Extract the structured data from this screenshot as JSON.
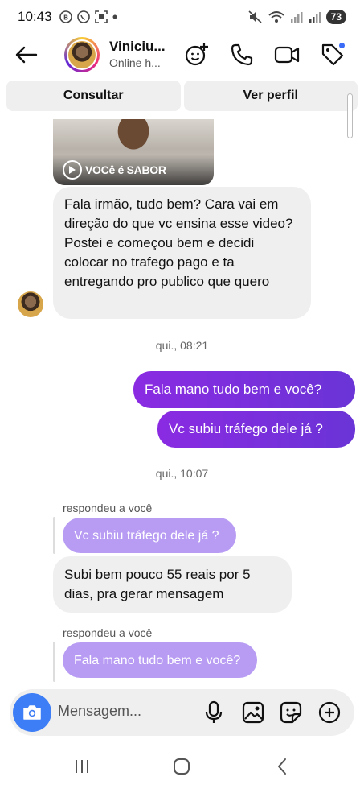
{
  "status_bar": {
    "time": "10:43",
    "battery": "73"
  },
  "header": {
    "name": "Viniciu...",
    "status": "Online h..."
  },
  "actions": {
    "consult": "Consultar",
    "profile": "Ver perfil"
  },
  "media": {
    "caption": "VOCê é SABOR"
  },
  "messages": [
    {
      "text": "Fala irmão, tudo bem? Cara vai em direção do que vc ensina esse video? Postei e começou bem e decidi colocar no trafego pago e ta entregando pro publico que quero"
    },
    {
      "text": "Fala mano tudo bem e você?"
    },
    {
      "text": "Vc subiu tráfego dele já ?"
    },
    {
      "text": "Subi bem pouco 55 reais por 5 dias, pra gerar mensagem"
    }
  ],
  "timestamps": [
    "qui., 08:21",
    "qui., 10:07"
  ],
  "replies": [
    {
      "label": "respondeu a você",
      "quoted": "Vc subiu tráfego dele já ?"
    },
    {
      "label": "respondeu a você",
      "quoted": "Fala mano tudo bem e você?"
    }
  ],
  "composer": {
    "placeholder": "Mensagem..."
  },
  "colors": {
    "outgoing": "#7a2ce0",
    "quoted": "#b89cf3",
    "camera": "#3d7ef6",
    "incoming": "#efefef"
  }
}
